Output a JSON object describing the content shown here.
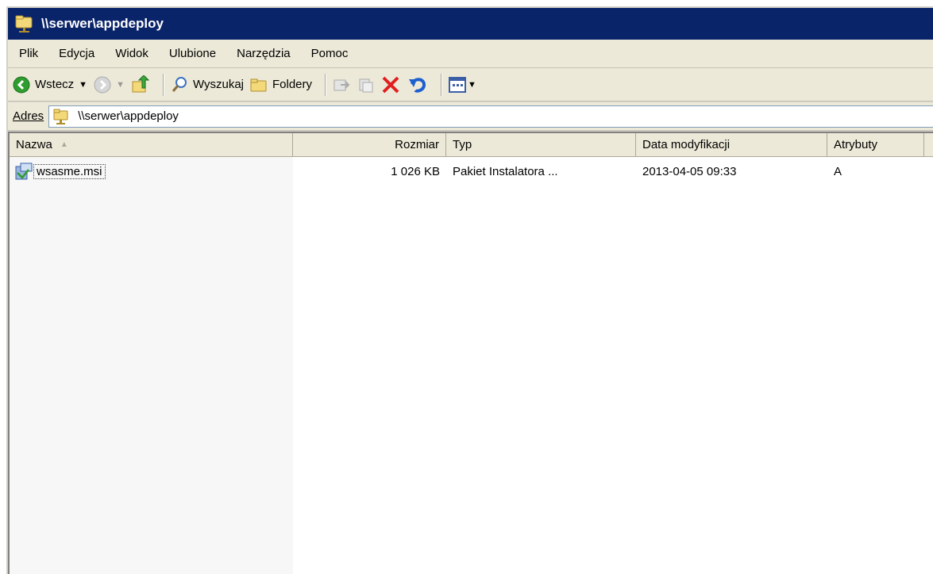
{
  "window": {
    "title": "\\\\serwer\\appdeploy"
  },
  "menu": {
    "items": [
      {
        "label": "Plik"
      },
      {
        "label": "Edycja"
      },
      {
        "label": "Widok"
      },
      {
        "label": "Ulubione"
      },
      {
        "label": "Narzędzia"
      },
      {
        "label": "Pomoc"
      }
    ]
  },
  "toolbar": {
    "back_label": "Wstecz",
    "search_label": "Wyszukaj",
    "folders_label": "Foldery"
  },
  "address": {
    "label": "Adres",
    "value": "\\\\serwer\\appdeploy"
  },
  "list": {
    "columns": [
      {
        "label": "Nazwa"
      },
      {
        "label": "Rozmiar"
      },
      {
        "label": "Typ"
      },
      {
        "label": "Data modyfikacji"
      },
      {
        "label": "Atrybuty"
      }
    ],
    "rows": [
      {
        "name": "wsasme.msi",
        "size": "1 026 KB",
        "type": "Pakiet Instalatora ...",
        "modified": "2013-04-05 09:33",
        "attributes": "A"
      }
    ]
  },
  "colors": {
    "titlebar": "#0a246a",
    "chrome": "#ece9d8",
    "delete_red": "#e02020",
    "back_green": "#2e9c2e"
  }
}
